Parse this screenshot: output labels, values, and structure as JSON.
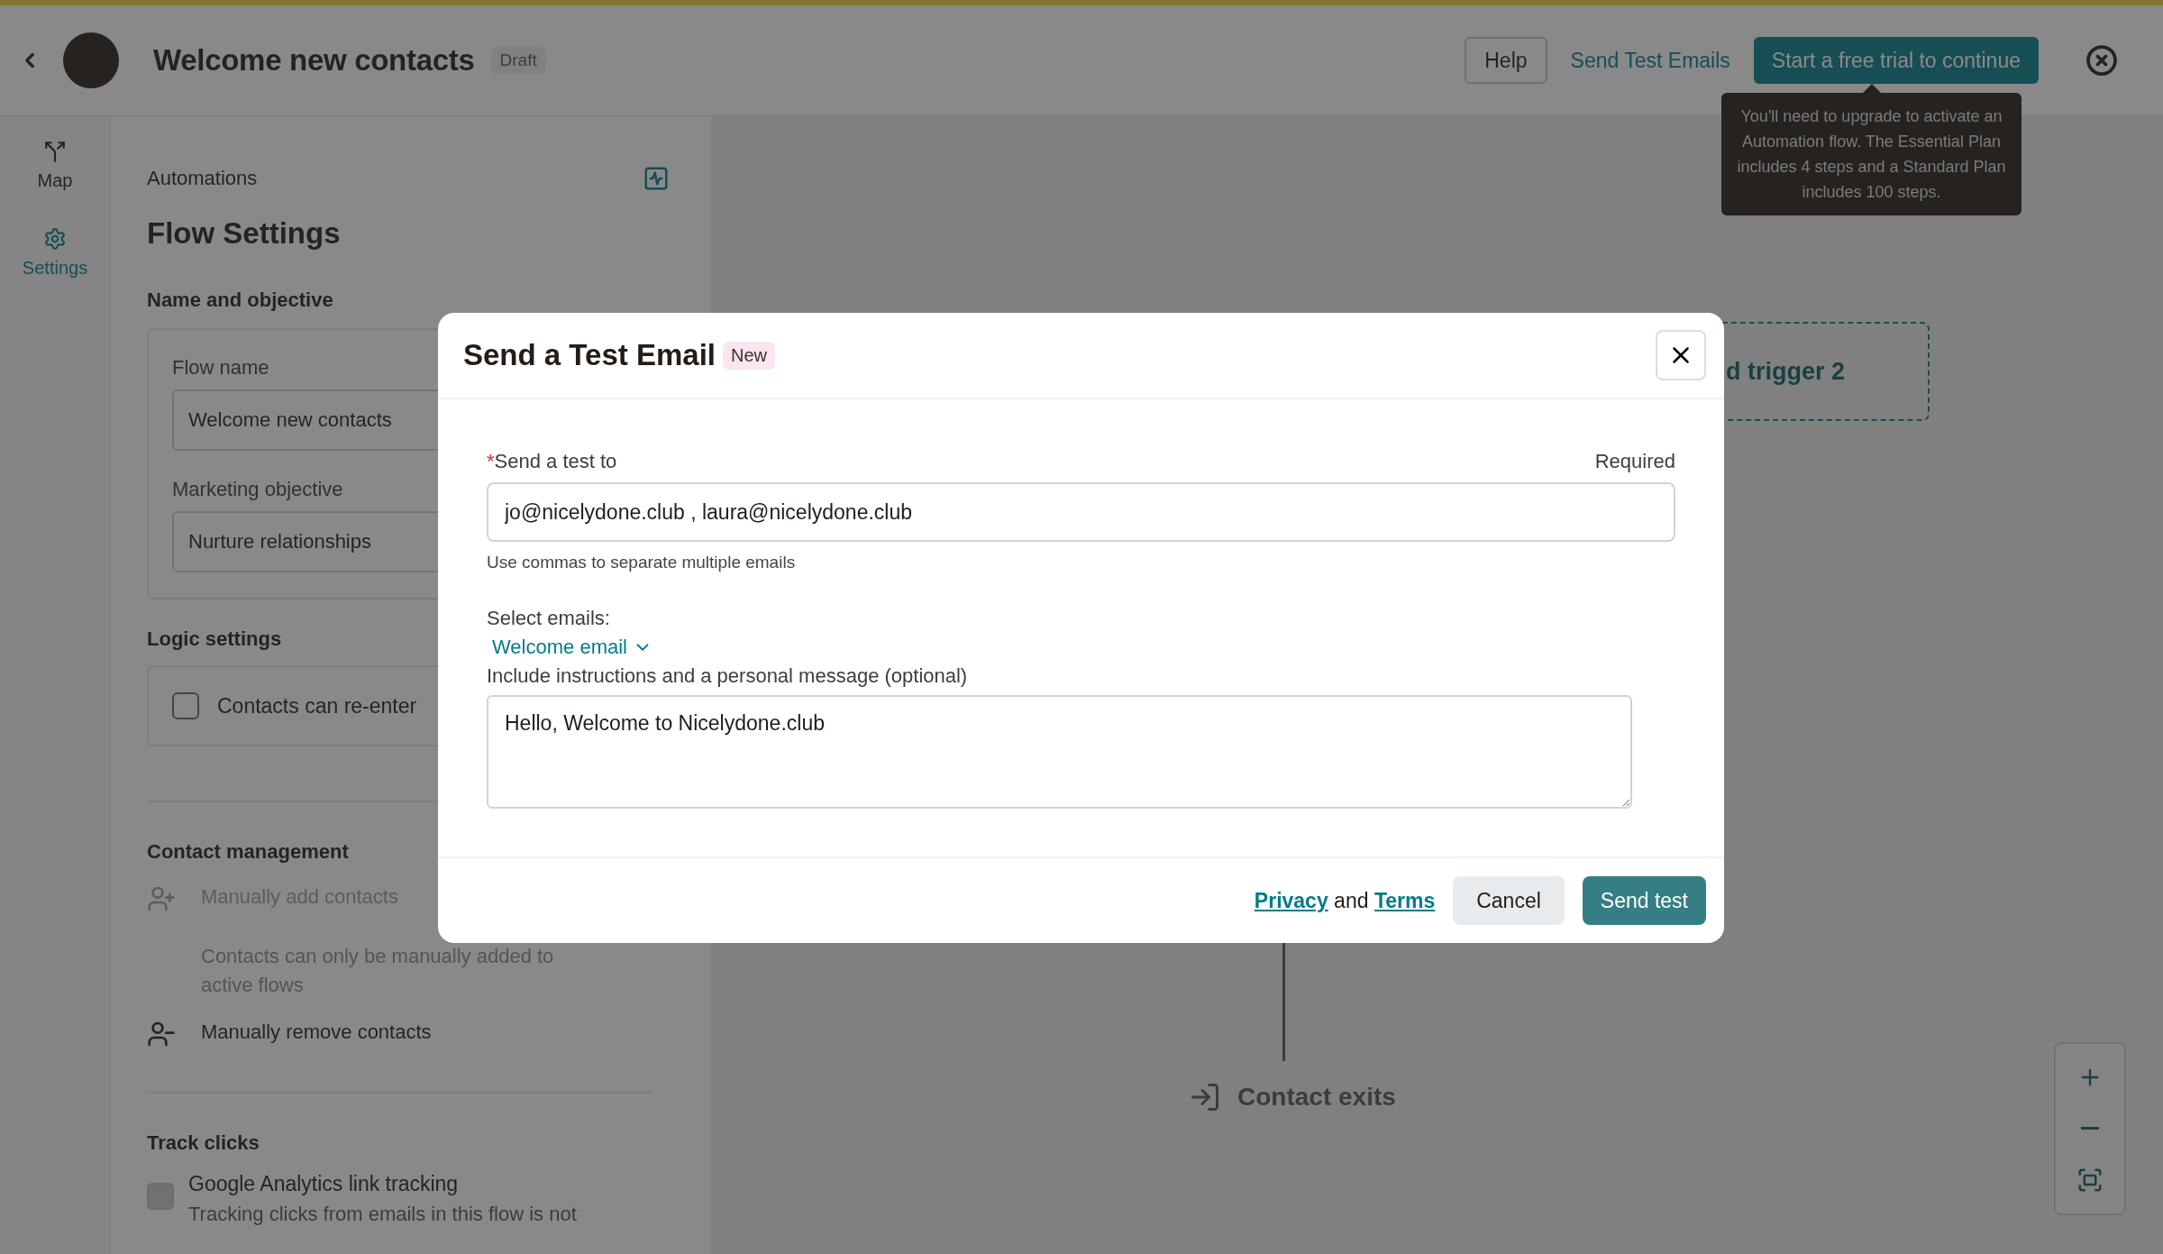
{
  "top_bar": {
    "title": "Welcome new contacts",
    "status": "Draft",
    "help_button": "Help",
    "test_link": "Send Test Emails",
    "trial_button": "Start a free trial to continue"
  },
  "tooltip": {
    "text": "You'll need to upgrade to activate an Automation flow. The Essential Plan includes 4 steps and a Standard Plan includes 100 steps."
  },
  "nav_rail": {
    "items": [
      {
        "label": "Map",
        "kind": "map",
        "selected": false
      },
      {
        "label": "Settings",
        "kind": "settings",
        "selected": true
      }
    ]
  },
  "settings_panel": {
    "breadcrumb": "Automations",
    "title": "Flow Settings",
    "name_section": {
      "heading": "Name and objective",
      "fields": [
        {
          "label": "Flow name",
          "value": "Welcome new contacts"
        },
        {
          "label": "Marketing objective",
          "value": "Nurture relationships"
        }
      ]
    },
    "logic_section": {
      "heading": "Logic settings",
      "checkbox": {
        "label": "Contacts can re-enter",
        "checked": false
      }
    },
    "contact_section": {
      "heading": "Contact management",
      "items": [
        {
          "kind": "add",
          "label": "Manually add contacts",
          "description": "Contacts can only be manually added to active flows",
          "disabled": true
        },
        {
          "kind": "remove",
          "label": "Manually remove contacts",
          "disabled": false
        }
      ]
    },
    "track_section": {
      "heading": "Track clicks",
      "checkbox": {
        "label": "Google Analytics link tracking",
        "description": "Tracking clicks from emails in this flow is not",
        "checked": false,
        "disabled": true
      }
    }
  },
  "canvas": {
    "trigger": "d trigger 2",
    "exit": "Contact exits"
  },
  "modal": {
    "title": "Send a Test Email",
    "badge": "New",
    "recipients": {
      "label": "Send a test to",
      "required_mark": "*",
      "required_text": "Required",
      "value": "jo@nicelydone.club , laura@nicelydone.club",
      "hint": "Use commas to separate multiple emails"
    },
    "select_label": "Select emails:",
    "select_value": "Welcome email",
    "message": {
      "label": "Include instructions and a personal message (optional)",
      "value": "Hello, Welcome to Nicelydone.club"
    },
    "footer": {
      "privacy": "Privacy",
      "and": "and",
      "terms": "Terms",
      "cancel": "Cancel",
      "submit": "Send test"
    }
  }
}
